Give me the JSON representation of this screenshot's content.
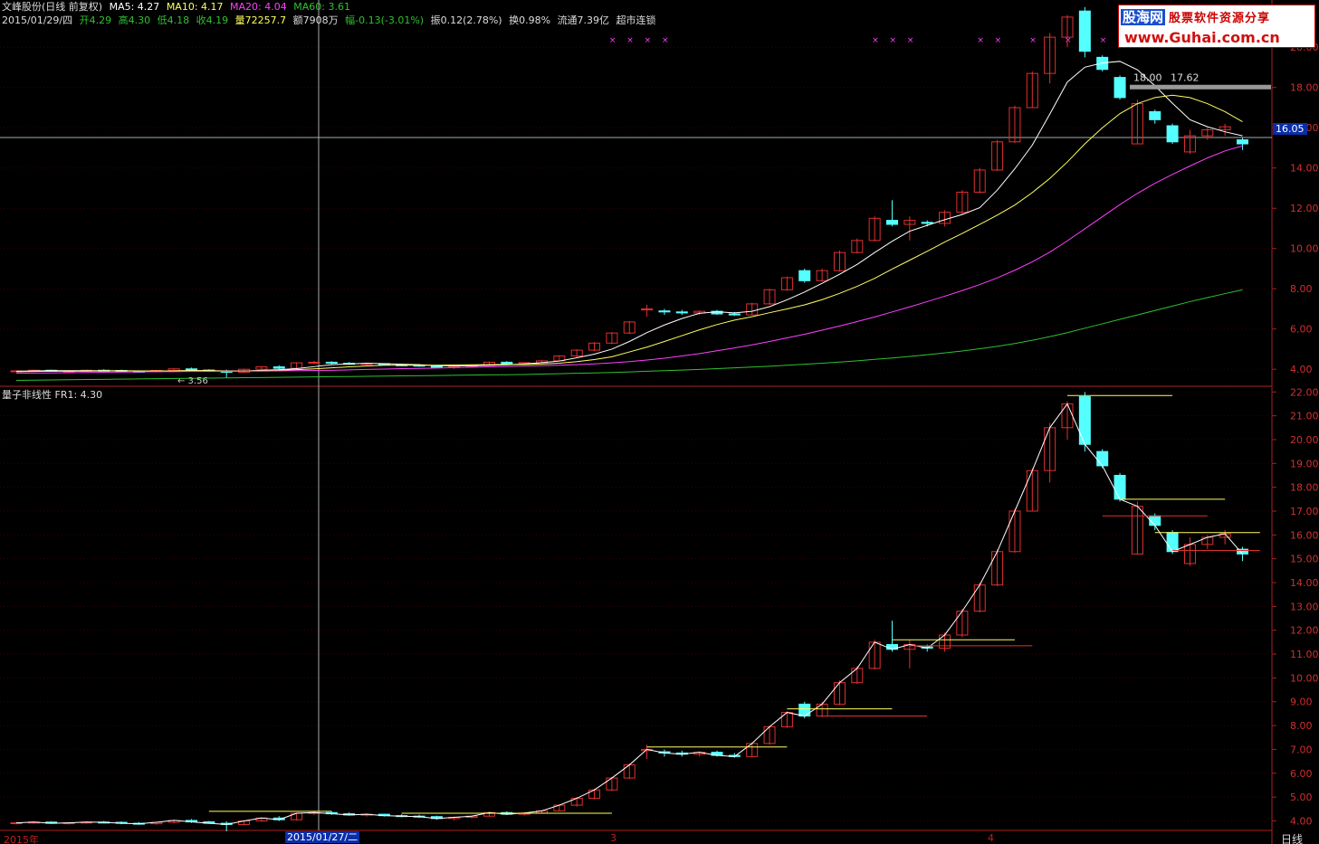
{
  "header": {
    "title": "文峰股份(日线 前复权)",
    "ma5": "MA5: 4.27",
    "ma10": "MA10: 4.17",
    "ma20": "MA20: 4.04",
    "ma60": "MA60: 3.61",
    "date": "2015/01/29/四",
    "open": "开4.29",
    "high": "高4.30",
    "low": "低4.18",
    "close": "收4.19",
    "volume": "量72257.7",
    "amount": "额7908万",
    "change": "幅-0.13(-3.01%)",
    "amplitude": "振0.12(2.78%)",
    "turnover": "换0.98%",
    "float": "流通7.39亿",
    "tag": "超市连锁"
  },
  "lower_header": "量子非线性  FR1: 4.30",
  "watermark": {
    "logo": "股海网",
    "slogan": "股票软件资源分享",
    "url": "www.Guhai.com.cn"
  },
  "crosshair": {
    "date_label": "2015/01/27/二",
    "price_label": "16.05"
  },
  "annotations": {
    "low_mark": "3.56",
    "level_a": "18.00",
    "level_b": "17.62"
  },
  "x_axis_labels": [
    "2015年",
    "3",
    "4"
  ],
  "period_tab": "日线",
  "colors": {
    "up": "#e03030",
    "down": "#54ffff",
    "ma5": "#ffffff",
    "ma10": "#ffff60",
    "ma20": "#ff40ff",
    "ma60": "#30c030",
    "axis": "#b02020"
  },
  "chart_data": [
    {
      "type": "candlestick",
      "title": "文峰股份(日线 前复权)",
      "ylim": [
        3.2,
        21.0
      ],
      "y_ticks": [
        "4.00",
        "6.00",
        "8.00",
        "10.00",
        "12.00",
        "14.00",
        "16.00",
        "18.00",
        "20.00"
      ],
      "ohlc": [
        [
          3.9,
          3.95,
          3.85,
          3.92
        ],
        [
          3.92,
          3.98,
          3.88,
          3.95
        ],
        [
          3.95,
          3.98,
          3.88,
          3.9
        ],
        [
          3.9,
          3.95,
          3.85,
          3.92
        ],
        [
          3.92,
          3.98,
          3.88,
          3.95
        ],
        [
          3.95,
          4.0,
          3.9,
          3.94
        ],
        [
          3.94,
          3.98,
          3.86,
          3.9
        ],
        [
          3.9,
          3.95,
          3.84,
          3.88
        ],
        [
          3.88,
          3.96,
          3.84,
          3.94
        ],
        [
          3.94,
          4.05,
          3.9,
          4.02
        ],
        [
          4.02,
          4.08,
          3.92,
          3.96
        ],
        [
          3.96,
          4.0,
          3.88,
          3.9
        ],
        [
          3.9,
          3.98,
          3.56,
          3.85
        ],
        [
          3.85,
          4.02,
          3.82,
          4.0
        ],
        [
          4.0,
          4.15,
          3.96,
          4.12
        ],
        [
          4.12,
          4.2,
          4.0,
          4.05
        ],
        [
          4.05,
          4.35,
          4.02,
          4.32
        ],
        [
          4.32,
          4.42,
          4.25,
          4.35
        ],
        [
          4.35,
          4.4,
          4.25,
          4.3
        ],
        [
          4.3,
          4.36,
          4.22,
          4.25
        ],
        [
          4.25,
          4.32,
          4.18,
          4.28
        ],
        [
          4.28,
          4.3,
          4.18,
          4.22
        ],
        [
          4.22,
          4.28,
          4.15,
          4.2
        ],
        [
          4.2,
          4.26,
          4.12,
          4.18
        ],
        [
          4.18,
          4.22,
          4.05,
          4.1
        ],
        [
          4.1,
          4.18,
          4.02,
          4.15
        ],
        [
          4.15,
          4.22,
          4.1,
          4.2
        ],
        [
          4.2,
          4.38,
          4.18,
          4.35
        ],
        [
          4.35,
          4.4,
          4.25,
          4.28
        ],
        [
          4.28,
          4.36,
          4.22,
          4.33
        ],
        [
          4.33,
          4.45,
          4.3,
          4.42
        ],
        [
          4.42,
          4.7,
          4.4,
          4.66
        ],
        [
          4.66,
          5.0,
          4.6,
          4.95
        ],
        [
          4.95,
          5.35,
          4.9,
          5.3
        ],
        [
          5.3,
          5.85,
          5.25,
          5.8
        ],
        [
          5.8,
          6.4,
          5.75,
          6.35
        ],
        [
          6.95,
          7.2,
          6.6,
          7.0
        ],
        [
          6.9,
          7.0,
          6.7,
          6.85
        ],
        [
          6.85,
          6.95,
          6.7,
          6.8
        ],
        [
          6.8,
          6.92,
          6.7,
          6.88
        ],
        [
          6.88,
          6.95,
          6.7,
          6.75
        ],
        [
          6.75,
          6.85,
          6.65,
          6.7
        ],
        [
          6.7,
          7.3,
          6.68,
          7.25
        ],
        [
          7.25,
          8.0,
          7.2,
          7.95
        ],
        [
          7.95,
          8.6,
          7.9,
          8.55
        ],
        [
          8.9,
          9.0,
          8.3,
          8.4
        ],
        [
          8.4,
          9.0,
          8.35,
          8.9
        ],
        [
          8.9,
          9.9,
          8.85,
          9.8
        ],
        [
          9.8,
          10.5,
          9.75,
          10.4
        ],
        [
          10.4,
          11.6,
          10.35,
          11.5
        ],
        [
          11.4,
          12.4,
          11.1,
          11.2
        ],
        [
          11.2,
          11.6,
          10.4,
          11.4
        ],
        [
          11.3,
          11.4,
          11.1,
          11.25
        ],
        [
          11.25,
          11.9,
          11.1,
          11.8
        ],
        [
          11.8,
          12.9,
          11.7,
          12.8
        ],
        [
          12.8,
          14.0,
          12.75,
          13.9
        ],
        [
          13.9,
          15.4,
          13.85,
          15.3
        ],
        [
          15.3,
          17.1,
          15.25,
          17.0
        ],
        [
          17.0,
          18.8,
          17.0,
          18.7
        ],
        [
          18.7,
          20.7,
          18.2,
          20.5
        ],
        [
          20.5,
          21.6,
          20.0,
          21.5
        ],
        [
          21.8,
          22.0,
          19.5,
          19.8
        ],
        [
          19.5,
          19.6,
          18.8,
          18.9
        ],
        [
          18.5,
          18.6,
          17.4,
          17.5
        ],
        [
          15.2,
          17.4,
          15.2,
          17.2
        ],
        [
          16.8,
          16.9,
          16.2,
          16.4
        ],
        [
          16.1,
          16.2,
          15.2,
          15.3
        ],
        [
          14.8,
          15.9,
          14.7,
          15.6
        ],
        [
          15.6,
          16.0,
          15.4,
          15.9
        ],
        [
          15.9,
          16.2,
          15.6,
          16.05
        ],
        [
          15.4,
          15.5,
          14.9,
          15.2
        ]
      ],
      "ma_series": [
        {
          "name": "MA5",
          "values": [
            3.9,
            3.92,
            3.93,
            3.93,
            3.93,
            3.93,
            3.93,
            3.92,
            3.91,
            3.92,
            3.94,
            3.93,
            3.9,
            3.91,
            3.95,
            3.98,
            4.03,
            4.13,
            4.23,
            4.26,
            4.3,
            4.28,
            4.25,
            4.23,
            4.18,
            4.17,
            4.17,
            4.2,
            4.22,
            4.26,
            4.33,
            4.41,
            4.57,
            4.75,
            5.0,
            5.38,
            5.82,
            6.2,
            6.52,
            6.78,
            6.86,
            6.8,
            6.88,
            7.11,
            7.45,
            7.84,
            8.27,
            8.72,
            9.21,
            9.8,
            10.36,
            10.86,
            11.15,
            11.43,
            11.69,
            12.03,
            12.9,
            13.96,
            15.14,
            16.68,
            18.27,
            19.01,
            19.22,
            19.3,
            18.88,
            18.09,
            17.22,
            16.4,
            16.05,
            15.8,
            15.6
          ]
        },
        {
          "name": "MA10",
          "values": [
            3.88,
            3.89,
            3.9,
            3.9,
            3.91,
            3.92,
            3.92,
            3.92,
            3.92,
            3.92,
            3.93,
            3.93,
            3.92,
            3.92,
            3.93,
            3.95,
            3.98,
            4.02,
            4.07,
            4.12,
            4.16,
            4.2,
            4.2,
            4.2,
            4.2,
            4.21,
            4.22,
            4.23,
            4.24,
            4.24,
            4.26,
            4.3,
            4.38,
            4.48,
            4.62,
            4.86,
            5.1,
            5.38,
            5.67,
            5.96,
            6.22,
            6.44,
            6.61,
            6.81,
            7.0,
            7.2,
            7.46,
            7.77,
            8.12,
            8.52,
            8.98,
            9.42,
            9.86,
            10.32,
            10.75,
            11.2,
            11.66,
            12.16,
            12.78,
            13.48,
            14.3,
            15.2,
            16.0,
            16.7,
            17.2,
            17.5,
            17.62,
            17.5,
            17.2,
            16.8,
            16.3
          ]
        },
        {
          "name": "MA20",
          "values": [
            3.8,
            3.81,
            3.82,
            3.83,
            3.84,
            3.85,
            3.86,
            3.87,
            3.88,
            3.88,
            3.89,
            3.89,
            3.9,
            3.9,
            3.91,
            3.92,
            3.93,
            3.94,
            3.95,
            3.97,
            3.99,
            4.01,
            4.03,
            4.04,
            4.06,
            4.08,
            4.1,
            4.12,
            4.14,
            4.16,
            4.18,
            4.2,
            4.23,
            4.27,
            4.32,
            4.38,
            4.46,
            4.55,
            4.66,
            4.78,
            4.92,
            5.06,
            5.21,
            5.38,
            5.56,
            5.74,
            5.94,
            6.15,
            6.37,
            6.6,
            6.85,
            7.1,
            7.36,
            7.63,
            7.91,
            8.21,
            8.54,
            8.92,
            9.34,
            9.82,
            10.38,
            10.98,
            11.58,
            12.18,
            12.74,
            13.24,
            13.68,
            14.1,
            14.5,
            14.85,
            15.1
          ]
        },
        {
          "name": "MA60",
          "values": [
            3.45,
            3.46,
            3.47,
            3.48,
            3.49,
            3.5,
            3.51,
            3.52,
            3.53,
            3.54,
            3.55,
            3.56,
            3.57,
            3.58,
            3.59,
            3.6,
            3.61,
            3.62,
            3.63,
            3.64,
            3.65,
            3.66,
            3.67,
            3.68,
            3.69,
            3.7,
            3.71,
            3.72,
            3.73,
            3.74,
            3.76,
            3.78,
            3.8,
            3.82,
            3.84,
            3.87,
            3.9,
            3.93,
            3.96,
            3.99,
            4.03,
            4.07,
            4.11,
            4.15,
            4.2,
            4.25,
            4.3,
            4.36,
            4.42,
            4.49,
            4.56,
            4.64,
            4.72,
            4.81,
            4.91,
            5.02,
            5.14,
            5.28,
            5.44,
            5.62,
            5.82,
            6.04,
            6.26,
            6.48,
            6.7,
            6.92,
            7.14,
            7.36,
            7.56,
            7.76,
            7.95
          ]
        }
      ]
    },
    {
      "type": "candlestick",
      "title": "量子非线性",
      "ylim": [
        3.6,
        22.2
      ],
      "y_ticks": [
        "4.00",
        "5.00",
        "6.00",
        "7.00",
        "8.00",
        "9.00",
        "10.00",
        "11.00",
        "12.00",
        "13.00",
        "14.00",
        "15.00",
        "16.00",
        "17.00",
        "18.00",
        "19.00",
        "20.00",
        "21.00",
        "22.00"
      ],
      "same_ohlc_as": "upper"
    }
  ]
}
